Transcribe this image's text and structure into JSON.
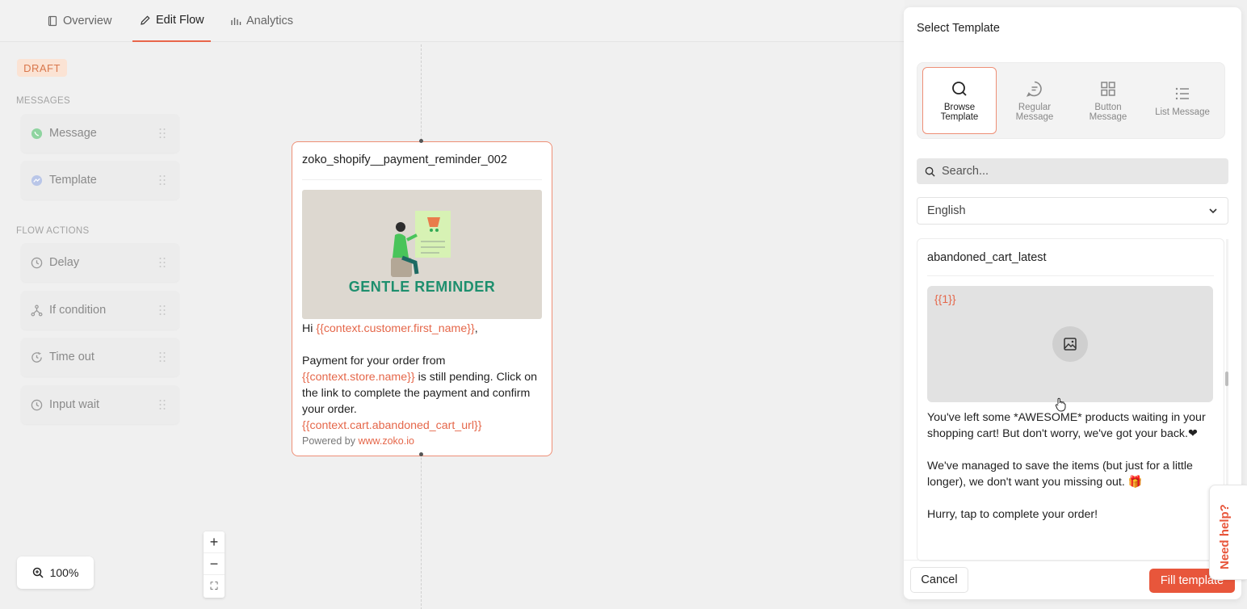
{
  "nav": {
    "tabs": [
      {
        "label": "Overview",
        "icon": "book-icon"
      },
      {
        "label": "Edit Flow",
        "icon": "pencil-icon"
      },
      {
        "label": "Analytics",
        "icon": "bar-chart-icon"
      }
    ],
    "active_tab": "Edit Flow"
  },
  "sidebar": {
    "status_badge": "DRAFT",
    "messages_label": "MESSAGES",
    "messages": [
      {
        "label": "Message",
        "icon": "whatsapp-icon"
      },
      {
        "label": "Template",
        "icon": "messenger-icon"
      }
    ],
    "flow_actions_label": "FLOW ACTIONS",
    "flow_actions": [
      {
        "label": "Delay",
        "icon": "clock-icon"
      },
      {
        "label": "If condition",
        "icon": "branch-icon"
      },
      {
        "label": "Time out",
        "icon": "timer-icon"
      },
      {
        "label": "Input wait",
        "icon": "clock-icon"
      }
    ]
  },
  "canvas": {
    "node": {
      "title": "zoko_shopify__payment_reminder_002",
      "image_banner": "GENTLE REMINDER",
      "greeting": "Hi ",
      "greeting_var": "{{context.customer.first_name}}",
      "greeting_end": ",",
      "line1": "Payment for your order from",
      "store_var": "{{context.store.name}}",
      "line2": " is still pending. Click on the link to complete the payment and confirm your order.",
      "cart_var": "{{context.cart.abandoned_cart_url}}",
      "powered_by": "Powered by ",
      "powered_link": "www.zoko.io"
    },
    "zoom_level": "100%",
    "zoom_in": "+",
    "zoom_out": "−",
    "fit": "⛶"
  },
  "panel": {
    "title": "Select Template",
    "types": [
      {
        "label": "Browse Template",
        "icon": "search-icon",
        "active": true
      },
      {
        "label": "Regular Message",
        "icon": "chat-bubble-icon",
        "active": false
      },
      {
        "label": "Button Message",
        "icon": "grid-icon",
        "active": false
      },
      {
        "label": "List Message",
        "icon": "list-icon",
        "active": false
      }
    ],
    "search_placeholder": "Search...",
    "language": "English",
    "template": {
      "name": "abandoned_cart_latest",
      "media_placeholder": "{{1}}",
      "para1": "You've left some *AWESOME* products waiting in your shopping cart! But don't worry, we've got your back.❤",
      "para2": "We've managed to save the items (but just for a little longer), we don't want you missing out. 🎁",
      "para3": "Hurry, tap to complete your order!"
    },
    "cancel_label": "Cancel",
    "fill_label": "Fill template"
  },
  "help_label": "Need help?",
  "colors": {
    "accent": "#e8563b",
    "variable": "#e5674a",
    "draft_bg": "#fbe3d4"
  }
}
